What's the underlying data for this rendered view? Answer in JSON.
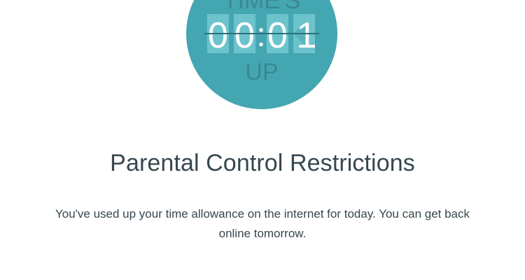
{
  "illustration": {
    "top_text": "TIME'S",
    "digits": [
      "0",
      "0",
      "0",
      "1"
    ],
    "separator": ":",
    "bottom_text": "UP",
    "circle_color": "#44a6b1",
    "tile_color": "#6cc3cc",
    "text_color": "#3a8893"
  },
  "main": {
    "title": "Parental Control Restrictions",
    "message": "You've used up your time allowance on the internet for today. You can get back online tomorrow."
  }
}
